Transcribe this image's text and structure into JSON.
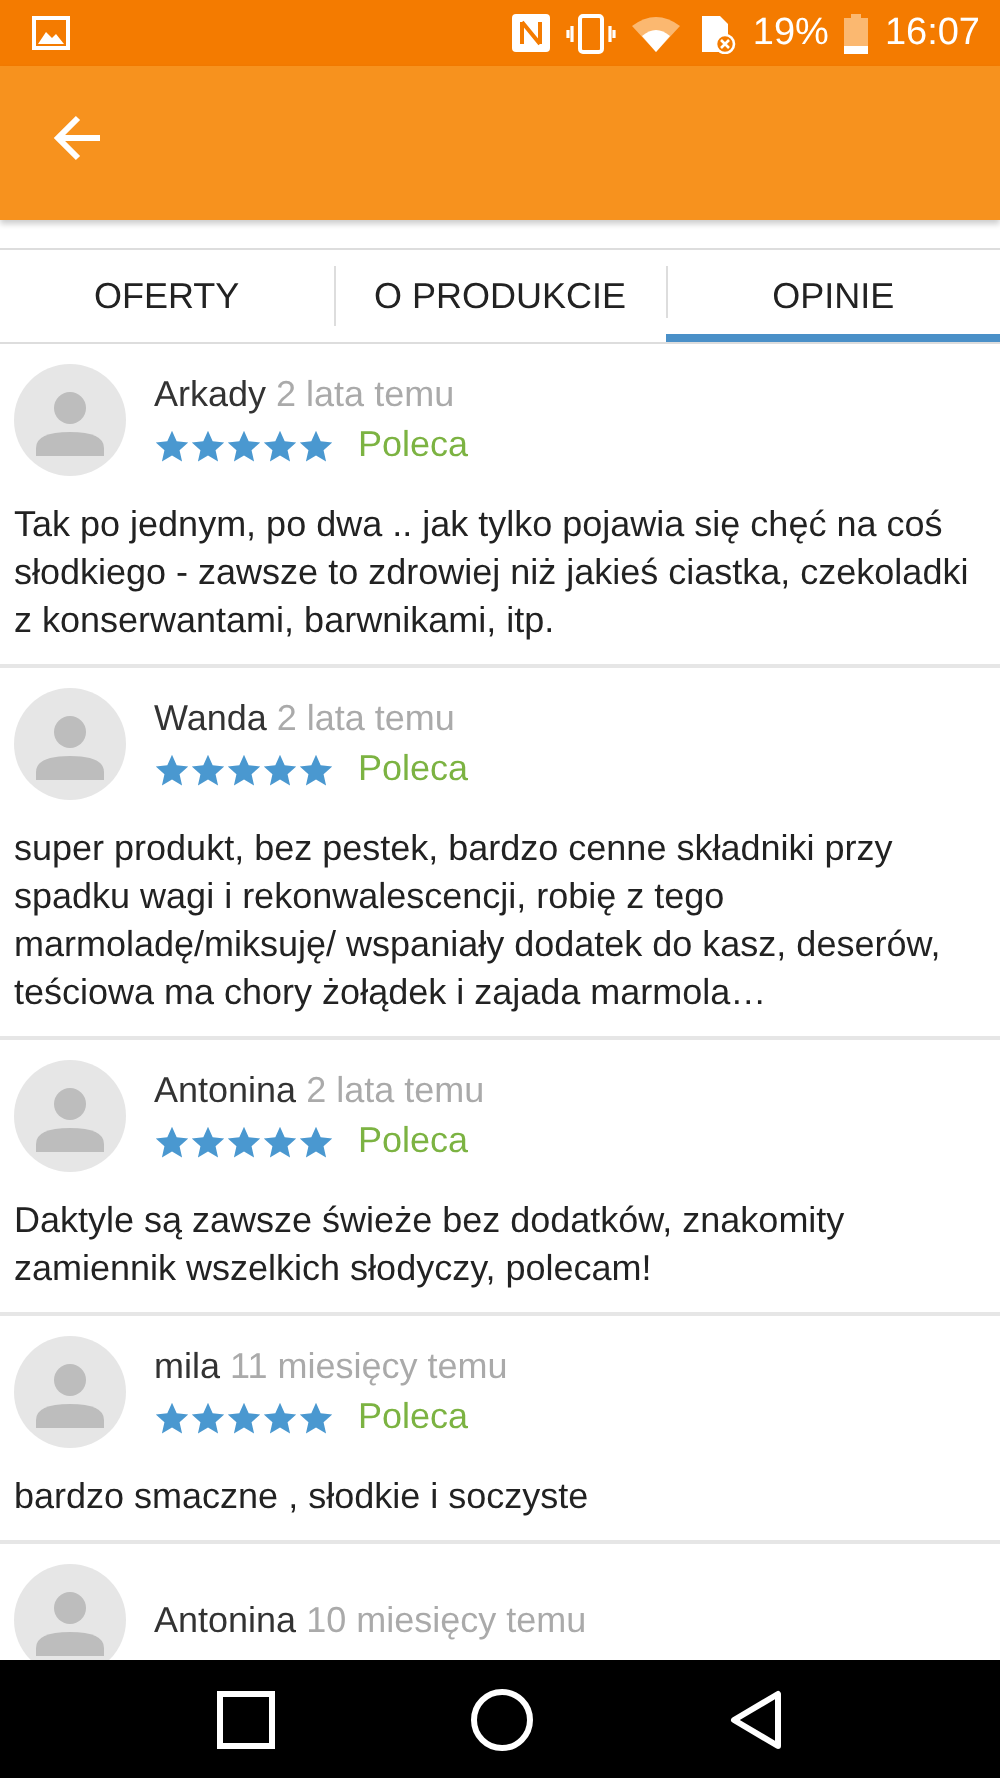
{
  "status_bar": {
    "battery": "19%",
    "time": "16:07"
  },
  "tabs": [
    {
      "label": "OFERTY",
      "selected": false
    },
    {
      "label": "O PRODUKCIE",
      "selected": false
    },
    {
      "label": "OPINIE",
      "selected": true
    }
  ],
  "reviews": [
    {
      "name": "Arkady",
      "time": "2 lata temu",
      "stars": 5,
      "recommendation": "Poleca",
      "text": "Tak po jednym, po dwa .. jak tylko pojawia się chęć na coś słodkiego - zawsze to zdrowiej niż jakieś ciastka, czekoladki z konserwantami, barwnikami, itp."
    },
    {
      "name": "Wanda",
      "time": "2 lata temu",
      "stars": 5,
      "recommendation": "Poleca",
      "text": "super produkt, bez pestek, bardzo cenne składniki przy spadku wagi i rekonwalescencji, robię z tego marmoladę/miksuję/ wspaniały dodatek do kasz, deserów, teściowa ma chory żołądek i zajada marmola…"
    },
    {
      "name": "Antonina",
      "time": "2 lata temu",
      "stars": 5,
      "recommendation": "Poleca",
      "text": "Daktyle są zawsze świeże bez dodatków, znakomity zamiennik wszelkich słodyczy, polecam!"
    },
    {
      "name": "mila",
      "time": "11 miesięcy temu",
      "stars": 5,
      "recommendation": "Poleca",
      "text": "bardzo smaczne , słodkie i soczyste"
    },
    {
      "name": "Antonina",
      "time": "10 miesięcy temu"
    }
  ]
}
